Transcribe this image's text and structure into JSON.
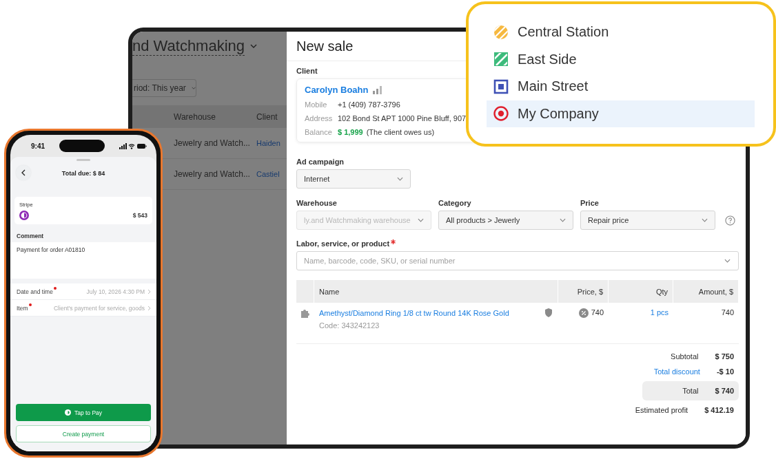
{
  "background_page": {
    "title": "nd Watchmaking",
    "period_filter": "riod: This year",
    "table": {
      "columns": [
        "Warehouse",
        "Client"
      ],
      "rows": [
        {
          "warehouse": "Jewelry and Watch...",
          "client": "Haiden"
        },
        {
          "warehouse": "Jewelry and Watch...",
          "client": "Castiel"
        }
      ]
    }
  },
  "new_sale": {
    "title": "New sale",
    "client": {
      "label": "Client",
      "name": "Carolyn Boahn",
      "fields": [
        {
          "label": "Mobile",
          "value": "+1 (409) 787-3796"
        },
        {
          "label": "Address",
          "value": "102 Bond St APT 1000 Pine Bluff, 907"
        }
      ],
      "balance": {
        "label": "Balance",
        "amount": "$ 1,999",
        "note": "(The client owes us)"
      }
    },
    "ad_campaign": {
      "label": "Ad campaign",
      "value": "Internet"
    },
    "selects": [
      {
        "label": "Warehouse",
        "value": "ly.and Watchmaking warehouse",
        "disabled": true
      },
      {
        "label": "Category",
        "value": "All products > Jewerly",
        "disabled": false
      },
      {
        "label": "Price",
        "value": "Repair price",
        "disabled": false
      }
    ],
    "product_search": {
      "label": "Labor, service, or product",
      "required": true,
      "placeholder": "Name, barcode, code, SKU, or serial number"
    },
    "items_table": {
      "columns": [
        "Name",
        "Price, $",
        "Qty",
        "Amount, $"
      ],
      "rows": [
        {
          "name": "Amethyst/Diamond Ring 1/8 ct tw Round 14K Rose Gold",
          "code": "Code: 343242123",
          "price": "740",
          "qty": "1 pcs",
          "amount": "740"
        }
      ]
    },
    "totals": [
      {
        "label": "Subtotal",
        "value": "$ 750",
        "kind": "plain"
      },
      {
        "label": "Total discount",
        "value": "-$ 10",
        "kind": "link"
      },
      {
        "label": "Total",
        "value": "$ 740",
        "kind": "total"
      },
      {
        "label": "Estimated profit",
        "value": "$ 412.19",
        "kind": "plain"
      }
    ]
  },
  "location_menu": {
    "items": [
      {
        "label": "Central Station",
        "kind": "hatched-circle",
        "color": "#f6b940",
        "selected": false
      },
      {
        "label": "East Side",
        "kind": "hatched-square",
        "color": "#3dbb7c",
        "selected": false
      },
      {
        "label": "Main Street",
        "kind": "framed-square",
        "color": "#3f51b5",
        "selected": false
      },
      {
        "label": "My Company",
        "kind": "target-circle",
        "color": "#e0202e",
        "selected": true
      }
    ]
  },
  "phone": {
    "time": "9:41",
    "title": "Total due: $ 84",
    "payment_method": {
      "name": "Stripe",
      "amount": "$ 543"
    },
    "comment": {
      "label": "Comment",
      "value": "Payment for order A01810"
    },
    "rows": [
      {
        "label": "Date and time",
        "required": true,
        "value": "July 10, 2026 4:30 PM"
      },
      {
        "label": "Item",
        "required": true,
        "value": "Client's payment for service, goods"
      }
    ],
    "buttons": [
      {
        "label": "Tap to Pay",
        "kind": "primary"
      },
      {
        "label": "Create payment",
        "kind": "outline"
      }
    ]
  }
}
